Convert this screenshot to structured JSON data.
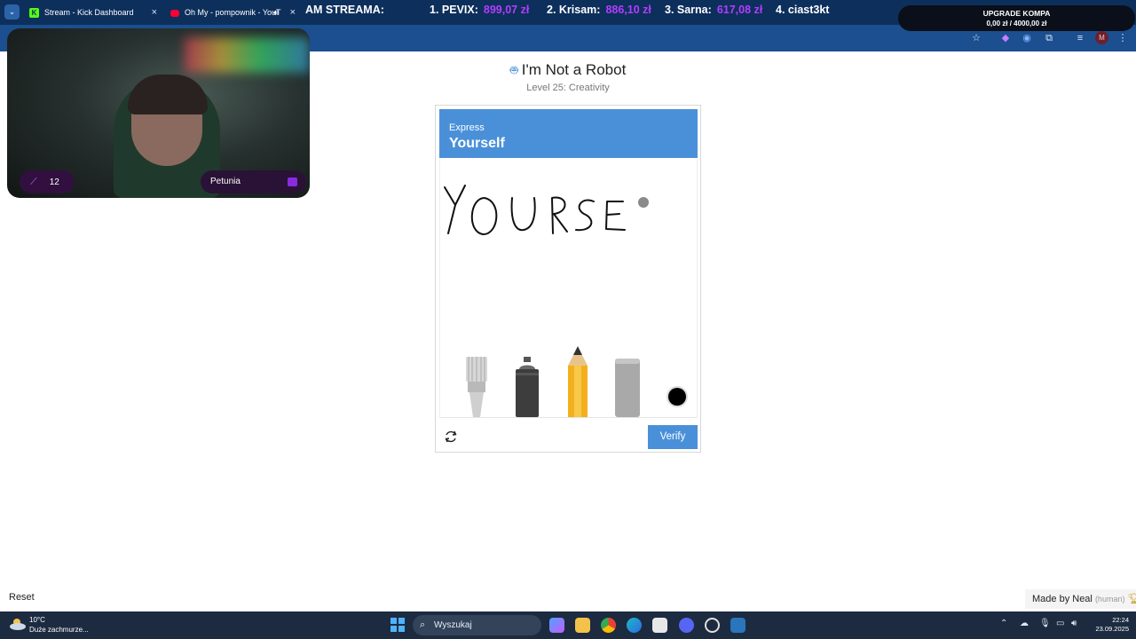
{
  "browser": {
    "tabs": [
      {
        "title": "Stream - Kick Dashboard",
        "icon": "kick-icon"
      },
      {
        "title": "Oh My - pompownik - YouT",
        "icon": "youtube-icon"
      }
    ]
  },
  "stream_overlay": {
    "leaderboard_title": "AM STREAMA:",
    "leaderboard": [
      {
        "name": "1. PEVIX:",
        "amount": "899,07 zł"
      },
      {
        "name": "2. Krisam:",
        "amount": "886,10 zł"
      },
      {
        "name": "3. Sarna:",
        "amount": "617,08 zł"
      },
      {
        "name": "4. ciast3kt",
        "amount": ""
      }
    ],
    "goal": {
      "title": "UPGRADE KOMPA",
      "progress": "0,00 zł  /  4000,00 zł"
    },
    "webcam": {
      "left_badge_count": "12",
      "right_badge_name": "Petunia"
    }
  },
  "captcha": {
    "title": "I'm Not a Robot",
    "level": "Level 25: Creativity",
    "header_small": "Express",
    "header_big": "Yourself",
    "tools": [
      "paintbrush-tool",
      "spray-paint-tool",
      "pencil-tool",
      "eraser-tool",
      "color-picker-black"
    ],
    "selected_color": "#000000",
    "verify_label": "Verify"
  },
  "page": {
    "reset_label": "Reset",
    "made_by": "Made by Neal",
    "made_by_note": "(human)"
  },
  "taskbar": {
    "weather_temp": "10°C",
    "weather_desc": "Duże zachmurze...",
    "search_placeholder": "Wyszukaj",
    "time": "22:24",
    "date": "23.09.2025"
  },
  "colors": {
    "accent": "#4a90d9",
    "overlay_amount": "#b43cff",
    "taskbar": "#1c2b40"
  }
}
